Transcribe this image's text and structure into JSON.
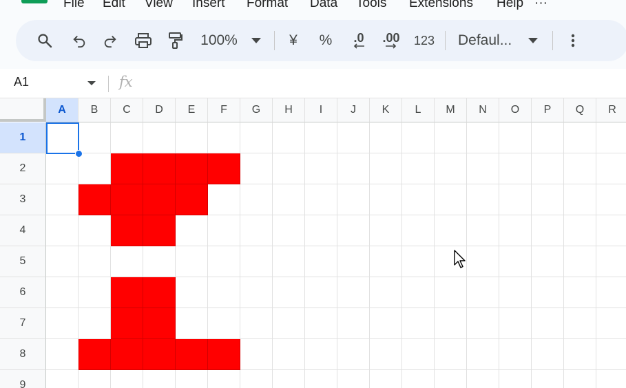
{
  "menu": {
    "items": [
      "File",
      "Edit",
      "View",
      "Insert",
      "Format",
      "Data",
      "Tools",
      "Extensions",
      "Help",
      "···"
    ]
  },
  "toolbar": {
    "search_icon": "search-icon",
    "undo_icon": "undo-icon",
    "redo_icon": "redo-icon",
    "print_icon": "print-icon",
    "paint_format_icon": "paint-format-icon",
    "zoom": "100%",
    "currency": "¥",
    "percent": "%",
    "decrease_decimal": ".0",
    "increase_decimal": ".00",
    "number_format": "123",
    "font": "Defaul...",
    "more_icon": "more-vert-icon"
  },
  "formula_bar": {
    "name_box": "A1",
    "fx": "fx",
    "formula": ""
  },
  "sheet": {
    "columns": [
      "A",
      "B",
      "C",
      "D",
      "E",
      "F",
      "G",
      "H",
      "I",
      "J",
      "K",
      "L",
      "M",
      "N",
      "O",
      "P",
      "Q",
      "R"
    ],
    "rows": [
      "1",
      "2",
      "3",
      "4",
      "5",
      "6",
      "7",
      "8",
      "9"
    ],
    "selected_cell": "A1",
    "fill_color": "#ff0000",
    "filled_cells": [
      "C2",
      "D2",
      "E2",
      "F2",
      "B3",
      "C3",
      "D3",
      "E3",
      "C4",
      "D4",
      "C6",
      "D6",
      "C7",
      "D7",
      "B8",
      "C8",
      "D8",
      "E8",
      "F8"
    ]
  }
}
